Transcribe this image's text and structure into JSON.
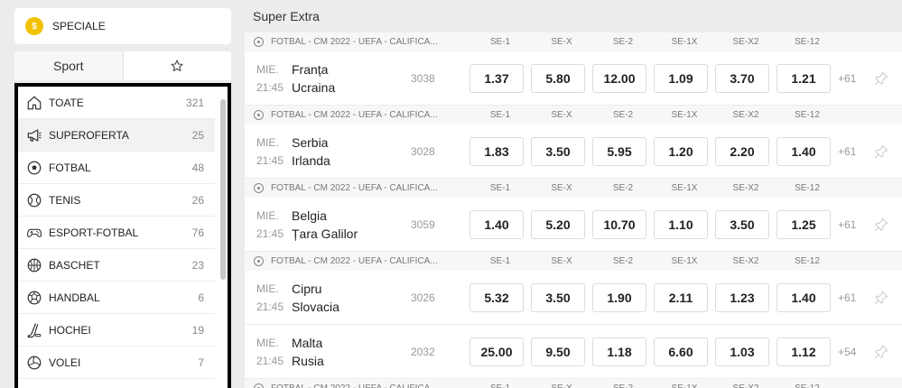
{
  "speciale": {
    "label": "SPECIALE",
    "icon": "coin-icon",
    "accent": "#f2c200"
  },
  "tabs": {
    "sport_label": "Sport",
    "favorites_icon": "star-icon"
  },
  "sports": [
    {
      "name": "TOATE",
      "count": "321",
      "icon": "home-icon"
    },
    {
      "name": "SUPEROFERTA",
      "count": "25",
      "icon": "megaphone-icon"
    },
    {
      "name": "FOTBAL",
      "count": "48",
      "icon": "soccer-ball-icon"
    },
    {
      "name": "TENIS",
      "count": "26",
      "icon": "tennis-ball-icon"
    },
    {
      "name": "ESPORT-FOTBAL",
      "count": "76",
      "icon": "gamepad-icon"
    },
    {
      "name": "BASCHET",
      "count": "23",
      "icon": "basketball-icon"
    },
    {
      "name": "HANDBAL",
      "count": "6",
      "icon": "handball-icon"
    },
    {
      "name": "HOCHEI",
      "count": "19",
      "icon": "hockey-stick-icon"
    },
    {
      "name": "VOLEI",
      "count": "7",
      "icon": "volleyball-icon"
    }
  ],
  "section_title": "Super Extra",
  "markets": [
    "SE-1",
    "SE-X",
    "SE-2",
    "SE-1X",
    "SE-X2",
    "SE-12"
  ],
  "league": "FOTBAL - CM 2022 - UEFA - CALIFICA...",
  "events": [
    {
      "day": "MIE.",
      "time": "21:45",
      "home": "Franța",
      "away": "Ucraina",
      "code": "3038",
      "odds": [
        "1.37",
        "5.80",
        "12.00",
        "1.09",
        "3.70",
        "1.21"
      ],
      "more": "+61"
    },
    {
      "day": "MIE.",
      "time": "21:45",
      "home": "Serbia",
      "away": "Irlanda",
      "code": "3028",
      "odds": [
        "1.83",
        "3.50",
        "5.95",
        "1.20",
        "2.20",
        "1.40"
      ],
      "more": "+61"
    },
    {
      "day": "MIE.",
      "time": "21:45",
      "home": "Belgia",
      "away": "Țara Galilor",
      "code": "3059",
      "odds": [
        "1.40",
        "5.20",
        "10.70",
        "1.10",
        "3.50",
        "1.25"
      ],
      "more": "+61"
    },
    {
      "day": "MIE.",
      "time": "21:45",
      "home": "Cipru",
      "away": "Slovacia",
      "code": "3026",
      "odds": [
        "5.32",
        "3.50",
        "1.90",
        "2.11",
        "1.23",
        "1.40"
      ],
      "more": "+61"
    },
    {
      "day": "MIE.",
      "time": "21:45",
      "home": "Malta",
      "away": "Rusia",
      "code": "2032",
      "odds": [
        "25.00",
        "9.50",
        "1.18",
        "6.60",
        "1.03",
        "1.12"
      ],
      "more": "+54"
    }
  ],
  "headers_shown_for": [
    0,
    1,
    2,
    3,
    5
  ]
}
